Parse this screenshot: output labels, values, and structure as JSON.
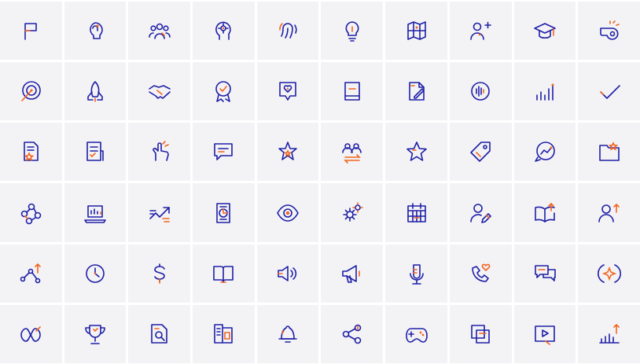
{
  "palette": {
    "stroke": "#1f1fa8",
    "accent": "#f26522",
    "tile": "#f3f3f5",
    "gap": "#ffffff"
  },
  "rows": [
    [
      "flag-icon",
      "brain-idea-icon",
      "team-icon",
      "gear-head-icon",
      "fingerprint-icon",
      "lightbulb-icon",
      "map-icon",
      "add-user-icon",
      "graduation-cap-icon",
      "whistle-icon"
    ],
    [
      "target-icon",
      "rocket-icon",
      "handshake-icon",
      "award-badge-icon",
      "heart-message-icon",
      "book-icon",
      "edit-document-icon",
      "voice-wave-icon",
      "bar-chart-icon",
      "check-icon"
    ],
    [
      "favorite-document-icon",
      "checklist-icon",
      "hand-gesture-icon",
      "chat-icon",
      "stars-icon",
      "user-exchange-icon",
      "star-icon",
      "tag-icon",
      "trend-chat-icon",
      "star-folder-icon"
    ],
    [
      "workflow-icon",
      "laptop-chart-icon",
      "growth-arrows-icon",
      "mobile-chart-icon",
      "eye-icon",
      "gears-icon",
      "calendar-icon",
      "user-edit-icon",
      "book-upload-icon",
      "user-growth-icon"
    ],
    [
      "path-arrow-icon",
      "clock-icon",
      "dollar-icon",
      "open-book-icon",
      "speaker-icon",
      "megaphone-icon",
      "microphone-icon",
      "call-heart-icon",
      "chat-bubbles-icon",
      "sparkle-icon"
    ],
    [
      "infinity-path-icon",
      "trophy-icon",
      "document-search-icon",
      "presentation-icon",
      "bell-icon",
      "share-icon",
      "gamepad-icon",
      "copy-icon",
      "video-play-icon",
      "growth-chart-icon"
    ]
  ]
}
